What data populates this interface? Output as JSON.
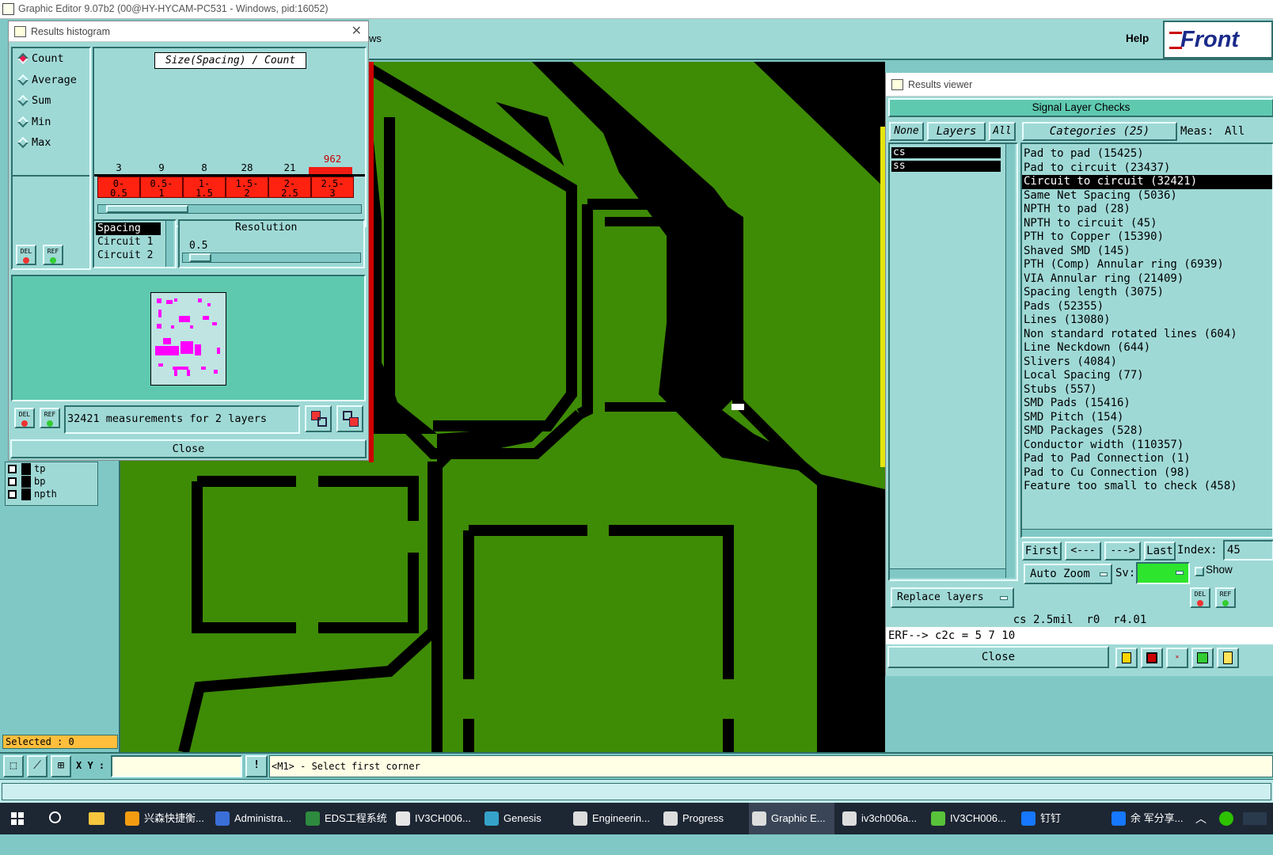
{
  "window": {
    "title": "Graphic Editor 9.07b2 (00@HY-HYCAM-PC531 - Windows, pid:16052)"
  },
  "menubar": {
    "partial_label": "ws",
    "help": "Help",
    "logo": "Front"
  },
  "histogram": {
    "title": "Results histogram",
    "modes": [
      {
        "label": "Count",
        "selected": true
      },
      {
        "label": "Average",
        "selected": false
      },
      {
        "label": "Sum",
        "selected": false
      },
      {
        "label": "Min",
        "selected": false
      },
      {
        "label": "Max",
        "selected": false
      }
    ],
    "chart_title": "Size(Spacing) / Count",
    "counts": [
      "3",
      "9",
      "8",
      "28",
      "21",
      "962"
    ],
    "bins": [
      "0-\n0.5",
      "0.5-\n1",
      "1-\n1.5",
      "1.5-\n2",
      "2-\n2.5",
      "2.5-\n3"
    ],
    "measure_list": [
      "Spacing",
      "Circuit 1",
      "Circuit 2"
    ],
    "resolution_label": "Resolution",
    "resolution_value": "0.5",
    "summary": "32421 measurements for 2 layers",
    "close": "Close",
    "del_label": "DEL",
    "ref_label": "REF"
  },
  "layers_panel": {
    "items": [
      "tp",
      "bp",
      "npth"
    ],
    "selected": "Selected : 0"
  },
  "status": {
    "xy_label": "X Y :",
    "xy_value": "",
    "prompt": "<M1> - Select first corner"
  },
  "results_viewer": {
    "title": "Results viewer",
    "header": "Signal Layer Checks",
    "none_btn": "None",
    "layers_btn": "Layers",
    "all_btn": "All",
    "categories_btn": "Categories (25)",
    "meas_label": "Meas:",
    "meas_value": "All",
    "layers": [
      "cs",
      "ss"
    ],
    "categories": [
      "Pad to pad (15425)",
      "Pad to circuit (23437)",
      "Circuit to circuit (32421)",
      "Same Net Spacing (5036)",
      "NPTH to pad (28)",
      "NPTH to circuit (45)",
      "PTH to Copper (15390)",
      "Shaved SMD (145)",
      "PTH (Comp) Annular ring (6939)",
      "VIA Annular ring (21409)",
      "Spacing length (3075)",
      "Pads (52355)",
      "Lines (13080)",
      "Non standard rotated lines (604)",
      "Line Neckdown (644)",
      "Slivers (4084)",
      "Local Spacing (77)",
      "Stubs (557)",
      "SMD Pads (15416)",
      "SMD Pitch (154)",
      "SMD Packages (528)",
      "Conductor width (110357)",
      "Pad to Pad Connection (1)",
      "Pad to Cu Connection (98)",
      "Feature too small to check (458)"
    ],
    "selected_category": "Circuit to circuit (32421)",
    "nav": {
      "first": "First",
      "prev": "<---",
      "next": "--->",
      "last": "Last",
      "index_label": "Index:",
      "index_value": "45"
    },
    "auto_zoom": "Auto Zoom",
    "sv_label": "Sv:",
    "show_label": "Show",
    "replace_layers": "Replace layers",
    "info_line": "cs 2.5mil  r0  r4.01",
    "erf_line": "ERF--> c2c = 5 7 10",
    "close": "Close"
  },
  "taskbar": {
    "items": [
      "兴森快捷衡...",
      "Administra...",
      "EDS工程系统",
      "IV3CH006...",
      "Genesis",
      "Engineerin...",
      "Progress",
      "Graphic E...",
      "iv3ch006a...",
      "IV3CH006...",
      "钉钉",
      "余  军分享..."
    ]
  },
  "colors": {
    "background": "#7fc8c6",
    "panel": "#9fd9d6",
    "copper": "#3e8b06",
    "bar": "#f21c12",
    "highlight": "#ff00ff"
  }
}
